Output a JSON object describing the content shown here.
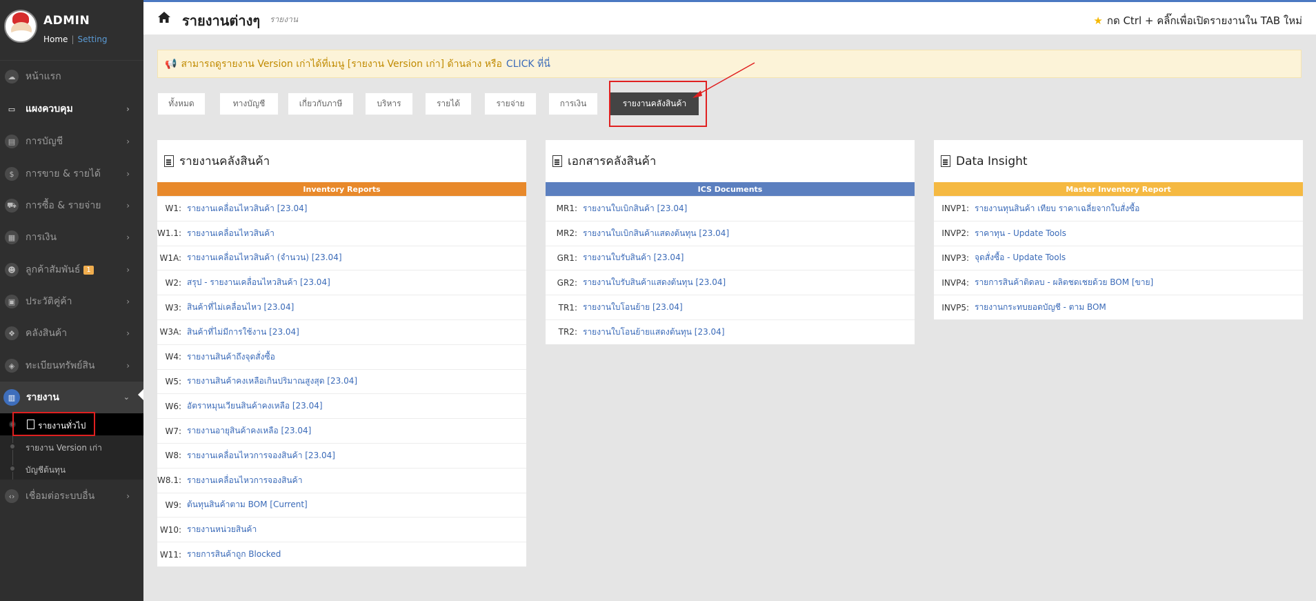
{
  "sidebar": {
    "profile": {
      "name": "ADMIN",
      "home": "Home",
      "separator": "|",
      "setting": "Setting"
    },
    "items": [
      {
        "label": "หน้าแรก",
        "icon": "cloud-icon"
      },
      {
        "label": "แผงควบคุม",
        "icon": "monitor-icon"
      },
      {
        "label": "การบัญชี",
        "icon": "book-icon"
      },
      {
        "label": "การขาย & รายได้",
        "icon": "dollar-icon"
      },
      {
        "label": "การซื้อ & รายจ่าย",
        "icon": "cart-icon"
      },
      {
        "label": "การเงิน",
        "icon": "calendar-icon"
      },
      {
        "label": "ลูกค้าสัมพันธ์",
        "icon": "users-icon",
        "badge": "1"
      },
      {
        "label": "ประวัติคู่ค้า",
        "icon": "contact-book-icon"
      },
      {
        "label": "คลังสินค้า",
        "icon": "cubes-icon"
      },
      {
        "label": "ทะเบียนทรัพย์สิน",
        "icon": "diamond-icon"
      },
      {
        "label": "รายงาน",
        "icon": "report-icon"
      },
      {
        "label": "เชื่อมต่อระบบอื่น",
        "icon": "code-icon"
      }
    ],
    "submenu": [
      {
        "label": "รายงานทั่วไป"
      },
      {
        "label": "รายงาน Version เก่า"
      },
      {
        "label": "บัญชีต้นทุน"
      }
    ]
  },
  "topbar": {
    "title": "รายงานต่างๆ",
    "subtitle": "รายงาน",
    "hint": "กด Ctrl + คลิ๊กเพื่อเปิดรายงานใน TAB ใหม่"
  },
  "alert": {
    "text": "สามารถดูรายงาน Version เก่าได้ที่เมนู [รายงาน Version เก่า] ด้านล่าง หรือ",
    "link": "CLICK ที่นี่"
  },
  "tabs": [
    "ทั้งหมด",
    "ทางบัญชี",
    "เกี่ยวกับภาษี",
    "บริหาร",
    "รายได้",
    "รายจ่าย",
    "การเงิน",
    "รายงานคลังสินค้า"
  ],
  "colors": {
    "orange": "#e8892b",
    "blue": "#5b7fbf",
    "yellow": "#f5b942",
    "link": "#3a6ab8"
  },
  "panels": [
    {
      "title": "รายงานคลังสินค้า",
      "band": "Inventory Reports",
      "rows": [
        {
          "code": "W1:",
          "label": "รายงานเคลื่อนไหวสินค้า [23.04]"
        },
        {
          "code": "W1.1:",
          "label": "รายงานเคลื่อนไหวสินค้า"
        },
        {
          "code": "W1A:",
          "label": "รายงานเคลื่อนไหวสินค้า (จำนวน) [23.04]"
        },
        {
          "code": "W2:",
          "label": "สรุป - รายงานเคลื่อนไหวสินค้า [23.04]"
        },
        {
          "code": "W3:",
          "label": "สินค้าที่ไม่เคลื่อนไหว [23.04]"
        },
        {
          "code": "W3A:",
          "label": "สินค้าที่ไม่มีการใช้งาน [23.04]"
        },
        {
          "code": "W4:",
          "label": "รายงานสินค้าถึงจุดสั่งซื้อ"
        },
        {
          "code": "W5:",
          "label": "รายงานสินค้าคงเหลือเกินปริมาณสูงสุด [23.04]"
        },
        {
          "code": "W6:",
          "label": "อัตราหมุนเวียนสินค้าคงเหลือ [23.04]"
        },
        {
          "code": "W7:",
          "label": "รายงานอายุสินค้าคงเหลือ [23.04]"
        },
        {
          "code": "W8:",
          "label": "รายงานเคลื่อนไหวการจองสินค้า [23.04]"
        },
        {
          "code": "W8.1:",
          "label": "รายงานเคลื่อนไหวการจองสินค้า"
        },
        {
          "code": "W9:",
          "label": "ต้นทุนสินค้าตาม BOM [Current]"
        },
        {
          "code": "W10:",
          "label": "รายงานหน่วยสินค้า"
        },
        {
          "code": "W11:",
          "label": "รายการสินค้าถูก Blocked"
        }
      ]
    },
    {
      "title": "เอกสารคลังสินค้า",
      "band": "ICS Documents",
      "rows": [
        {
          "code": "MR1:",
          "label": "รายงานใบเบิกสินค้า [23.04]"
        },
        {
          "code": "MR2:",
          "label": "รายงานใบเบิกสินค้าแสดงต้นทุน [23.04]"
        },
        {
          "code": "GR1:",
          "label": "รายงานใบรับสินค้า [23.04]"
        },
        {
          "code": "GR2:",
          "label": "รายงานใบรับสินค้าแสดงต้นทุน [23.04]"
        },
        {
          "code": "TR1:",
          "label": "รายงานใบโอนย้าย [23.04]"
        },
        {
          "code": "TR2:",
          "label": "รายงานใบโอนย้ายแสดงต้นทุน [23.04]"
        }
      ]
    },
    {
      "title": "Data Insight",
      "band": "Master Inventory Report",
      "rows": [
        {
          "code": "INVP1:",
          "label": "รายงานทุนสินค้า เทียบ ราคาเฉลี่ยจากใบสั่งซื้อ"
        },
        {
          "code": "INVP2:",
          "label": "ราคาทุน - Update Tools"
        },
        {
          "code": "INVP3:",
          "label": "จุดสั่งซื้อ - Update Tools"
        },
        {
          "code": "INVP4:",
          "label": "รายการสินค้าติดลบ - ผลิตชดเชยด้วย BOM [ขาย]"
        },
        {
          "code": "INVP5:",
          "label": "รายงานกระทบยอดบัญชี - ตาม BOM"
        }
      ]
    }
  ]
}
